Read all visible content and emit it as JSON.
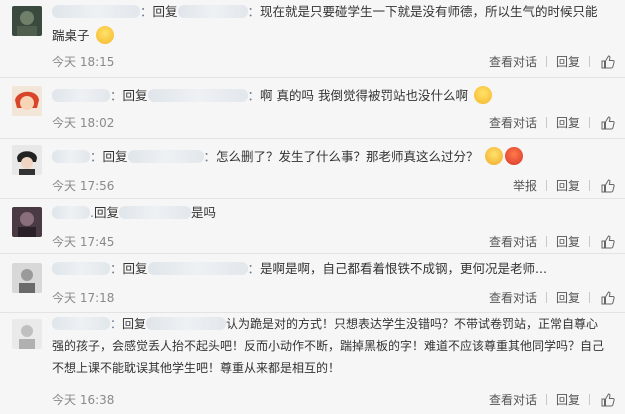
{
  "labels": {
    "reply": "回复",
    "view_conversation": "查看对话",
    "report": "举报",
    "reply_action": "回复"
  },
  "comments": [
    {
      "time": "今天 18:15",
      "text": "现在就是只要碰学生一下就是没有师德，所以生气的时候只能踹桌子",
      "action1": "查看对话",
      "action2": "回复"
    },
    {
      "time": "今天 18:02",
      "text": "啊 真的吗 我倒觉得被罚站也没什么啊",
      "action1": "查看对话",
      "action2": "回复"
    },
    {
      "time": "今天 17:56",
      "text": "怎么删了？发生了什么事？那老师真这么过分？",
      "action1": "举报",
      "action2": "回复"
    },
    {
      "time": "今天 17:45",
      "text": "是吗",
      "action1": "查看对话",
      "action2": "回复"
    },
    {
      "time": "今天 17:18",
      "text": "是啊是啊，自己都看着恨铁不成钢，更何况是老师...",
      "action1": "查看对话",
      "action2": "回复"
    },
    {
      "time": "今天 16:38",
      "text": "认为跪是对的方式！只想表达学生没错吗？不带试卷罚站，正常自尊心强的孩子，会感觉丢人抬不起头吧！反而小动作不断，踹掉黑板的字！难道不应该尊重其他同学吗？自己不想上课不能耽误其他学生吧！尊重从来都是相互的！",
      "action1": "查看对话",
      "action2": "回复"
    }
  ],
  "icons": {
    "like": "thumbs-up-icon",
    "emoji_laugh": "laughing-face-emoji",
    "emoji_shock": "shocked-face-emoji",
    "emoji_angry": "angry-face-emoji"
  },
  "colors": {
    "background": "#f6f6f6",
    "link": "#5a6f87",
    "meta": "#8a8a8a",
    "divider": "#e3e3e3"
  }
}
